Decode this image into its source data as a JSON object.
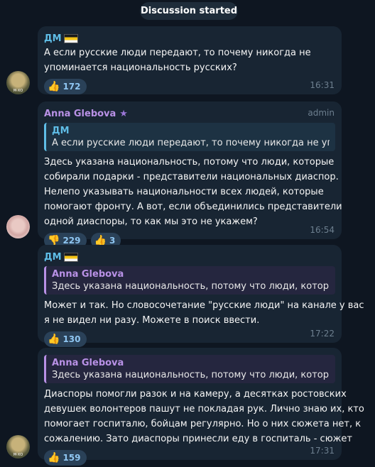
{
  "header": {
    "pill": "Discussion started"
  },
  "messages": [
    {
      "sender": "ДМ",
      "text": [
        "А если русские люди передают, то почему никогда не",
        "упоминается национальность русских?"
      ],
      "reactions": [
        {
          "emoji": "👍",
          "count": "172"
        }
      ],
      "time": "16:31"
    },
    {
      "sender": "Anna Glebova",
      "role": "admin",
      "quote": {
        "name": "ДМ",
        "text": "А если русские люди передают, то почему никогда не упоми..."
      },
      "text": [
        "Здесь указана национальность, потому что люди, которые",
        "собирали подарки - представители национальных диаспор.",
        "Нелепо указывать национальности всех людей, которые",
        "помогают фронту. А вот, если объединились представители",
        "одной диаспоры, то как мы это не укажем?"
      ],
      "reactions": [
        {
          "emoji": "👎",
          "count": "229"
        },
        {
          "emoji": "👍",
          "count": "3"
        }
      ],
      "time": "16:54"
    },
    {
      "sender": "ДМ",
      "quote": {
        "name": "Anna Glebova",
        "text": "Здесь указана национальность, потому что люди, которые с..."
      },
      "text": [
        "Может и так. Но словосочетание \"русские люди\" на канале у вас",
        "я не видел ни разу. Можете в поиск ввести."
      ],
      "reactions": [
        {
          "emoji": "👍",
          "count": "130"
        }
      ],
      "time": "17:22"
    },
    {
      "quote": {
        "name": "Anna Glebova",
        "text": "Здесь указана национальность, потому что люди, которые с..."
      },
      "text": [
        "Диаспоры помогли разок и на камеру, а десятках ростовских",
        "девушек волонтеров пашут не покладая рук. Лично знаю их, кто",
        "помогает госпиталю, бойцам регулярно. Но о них сюжета нет, к",
        "сожалению. Зато диаспоры принесли еду в госпиталь - сюжет"
      ],
      "reactions": [
        {
          "emoji": "👍",
          "count": "159"
        }
      ],
      "time": "17:31"
    }
  ],
  "avatars": {
    "dm_caption": "М·ХО"
  }
}
